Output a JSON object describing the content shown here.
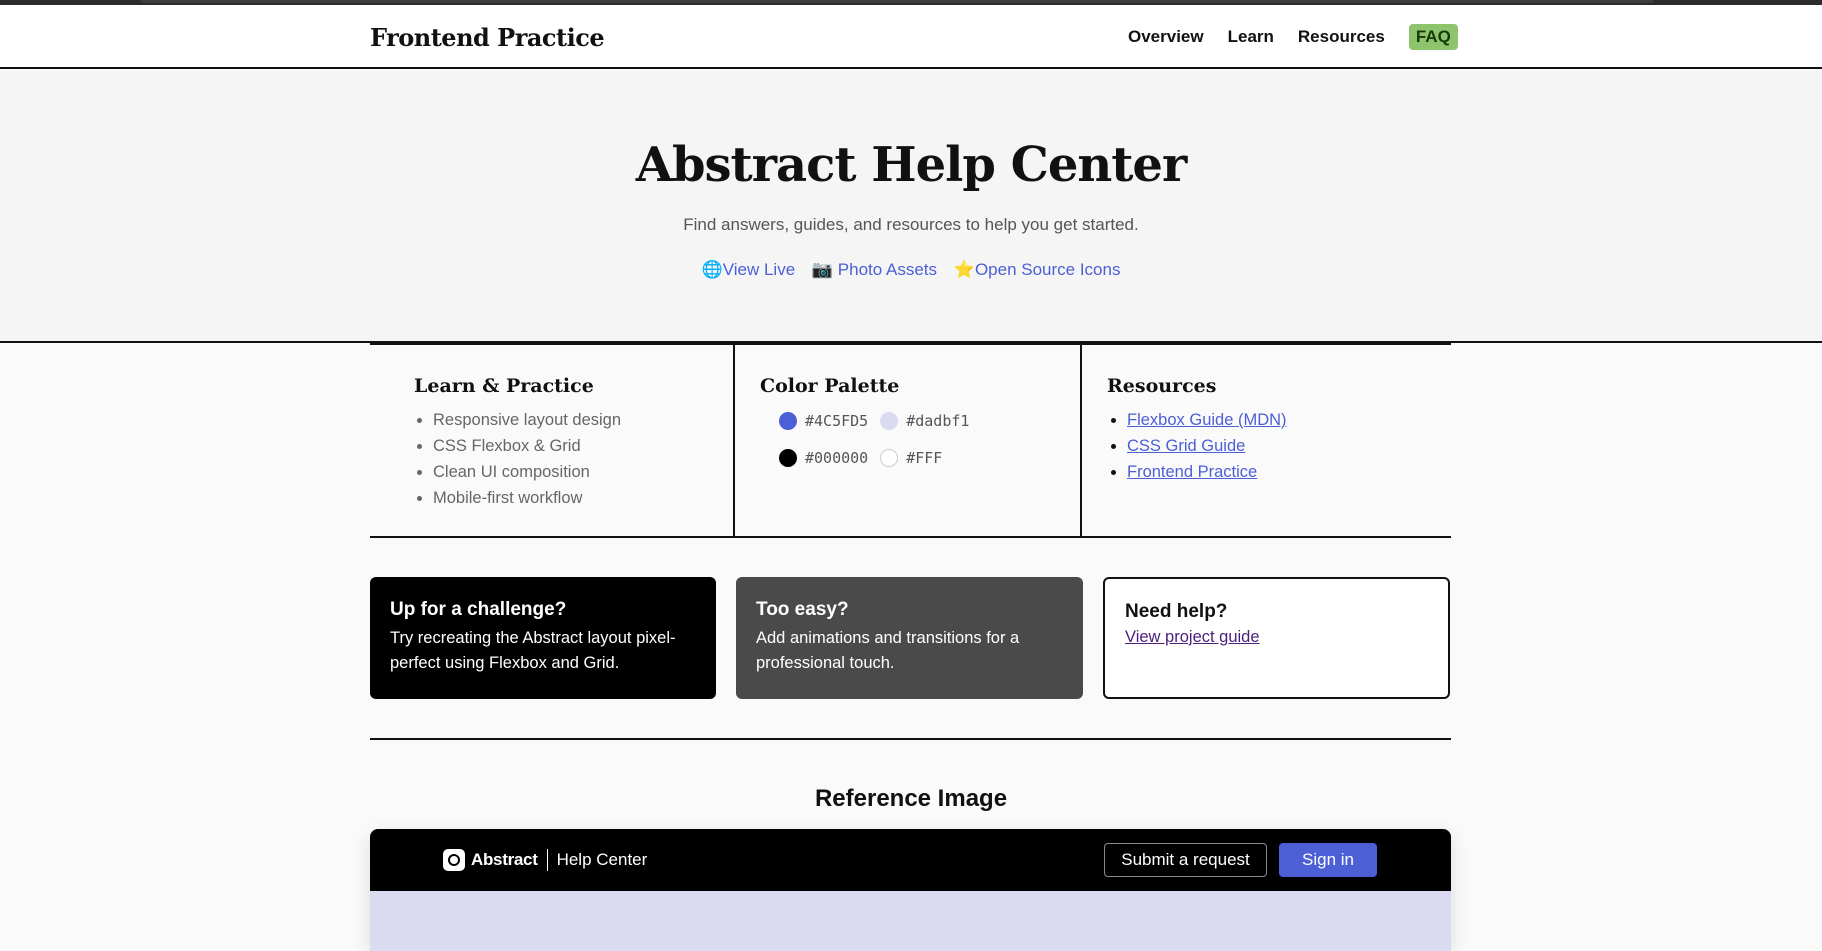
{
  "header": {
    "logo": "Frontend Practice",
    "nav": [
      "Overview",
      "Learn",
      "Resources",
      "FAQ"
    ]
  },
  "hero": {
    "title": "Abstract Help Center",
    "subtitle": "Find answers, guides, and resources to help you get started.",
    "links": [
      {
        "icon": "globe-icon",
        "glyph": "🌐",
        "label": "View Live"
      },
      {
        "icon": "camera-icon",
        "glyph": "📷",
        "label": "Photo Assets"
      },
      {
        "icon": "star-icon",
        "glyph": "⭐",
        "label": "Open Source Icons"
      }
    ]
  },
  "learn": {
    "title": "Learn & Practice",
    "items": [
      "Responsive layout design",
      "CSS Flexbox & Grid",
      "Clean UI composition",
      "Mobile-first workflow"
    ]
  },
  "palette": {
    "title": "Color Palette",
    "colors": [
      {
        "hex": "#4C5FD5",
        "color": "#4C5FD5"
      },
      {
        "hex": "#dadbf1",
        "color": "#dadbf1"
      },
      {
        "hex": "#000000",
        "color": "#000000"
      },
      {
        "hex": "#FFF",
        "color": "#FFFFFF"
      }
    ]
  },
  "resources": {
    "title": "Resources",
    "links": [
      "Flexbox Guide (MDN)",
      "CSS Grid Guide",
      "Frontend Practice"
    ]
  },
  "cards": {
    "challenge": {
      "title": "Up for a challenge?",
      "text": "Try recreating the Abstract layout pixel-perfect using Flexbox and Grid."
    },
    "easy": {
      "title": "Too easy?",
      "text": "Add animations and transitions for a professional touch."
    },
    "help": {
      "title": "Need help?",
      "link": "View project guide"
    }
  },
  "reference": {
    "title": "Reference Image",
    "brand": "Abstract",
    "brand_sub": "Help Center",
    "submit_label": "Submit a request",
    "signin_label": "Sign in"
  },
  "colors": {
    "accent": "#4C5FD5",
    "faq_badge": "#8fc46f",
    "hero_band": "#dadbf1"
  }
}
